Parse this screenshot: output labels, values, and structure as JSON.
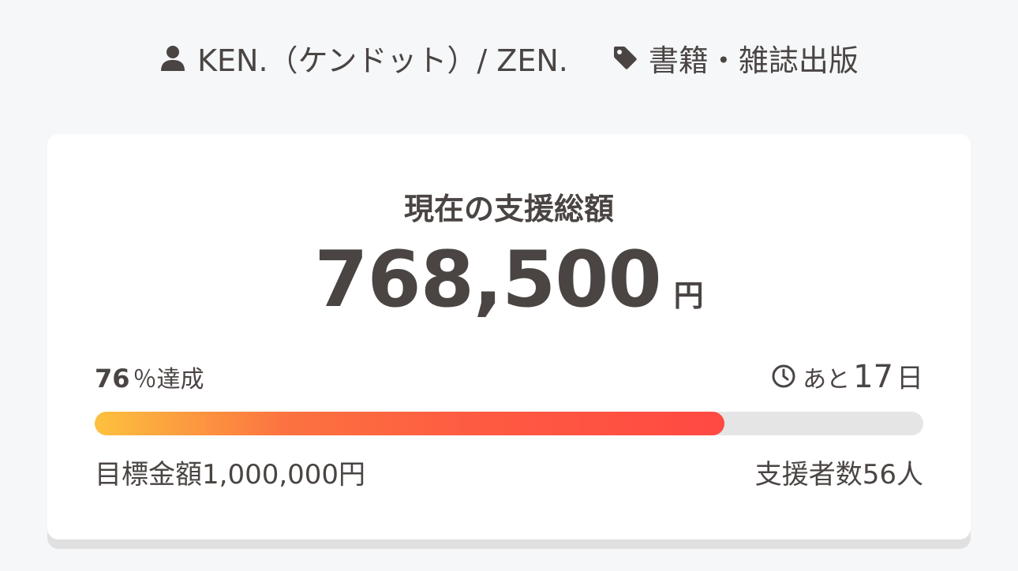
{
  "meta": {
    "author": "KEN.（ケンドット）/ ZEN.",
    "category": "書籍・雑誌出版",
    "icons": {
      "author": "user-icon",
      "category": "tag-icon",
      "deadline": "clock-icon"
    }
  },
  "funding": {
    "title": "現在の支援総額",
    "amount": "768,500",
    "currency": "円",
    "percent": "76",
    "percent_suffix": "％達成",
    "progress_fraction": 0.76,
    "remaining_prefix": "あと",
    "remaining_days": "17",
    "remaining_unit": "日",
    "target_label": "目標金額",
    "target_value": "1,000,000円",
    "supporters_label": "支援者数",
    "supporters_value": "56人"
  },
  "colors": {
    "page_bg": "#f5f7f9",
    "card_bg": "#ffffff",
    "text": "#4a4543",
    "progress_track": "#e5e5e5",
    "progress_start": "#fdc13f",
    "progress_end": "#ff4943"
  }
}
